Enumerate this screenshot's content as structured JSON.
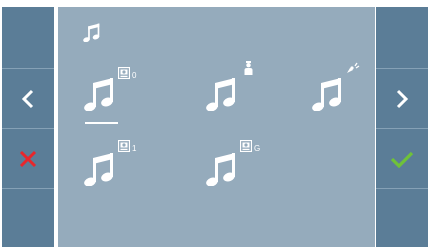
{
  "header": {
    "icon": "music-note-icon"
  },
  "navigation": {
    "prev_icon": "chevron-left-icon",
    "next_icon": "chevron-right-icon"
  },
  "actions": {
    "cancel_icon": "cross-icon",
    "confirm_icon": "check-icon"
  },
  "ringtones": [
    {
      "id": "panel-0",
      "icon": "music-note-icon",
      "badge_icon": "door-panel-icon",
      "badge_label": "0",
      "selected": true
    },
    {
      "id": "concierge",
      "icon": "music-note-icon",
      "badge_icon": "concierge-icon",
      "badge_label": "",
      "selected": false
    },
    {
      "id": "doorbell",
      "icon": "music-note-icon",
      "badge_icon": "doorbell-icon",
      "badge_label": "",
      "selected": false
    },
    {
      "id": "panel-1",
      "icon": "music-note-icon",
      "badge_icon": "door-panel-icon",
      "badge_label": "1",
      "selected": false
    },
    {
      "id": "panel-g",
      "icon": "music-note-icon",
      "badge_icon": "door-panel-icon",
      "badge_label": "G",
      "selected": false
    }
  ],
  "colors": {
    "side_panel": "#5b7d97",
    "main_panel": "#95abbc",
    "cancel": "#e8262b",
    "confirm": "#6fc238",
    "icon": "#ffffff"
  }
}
